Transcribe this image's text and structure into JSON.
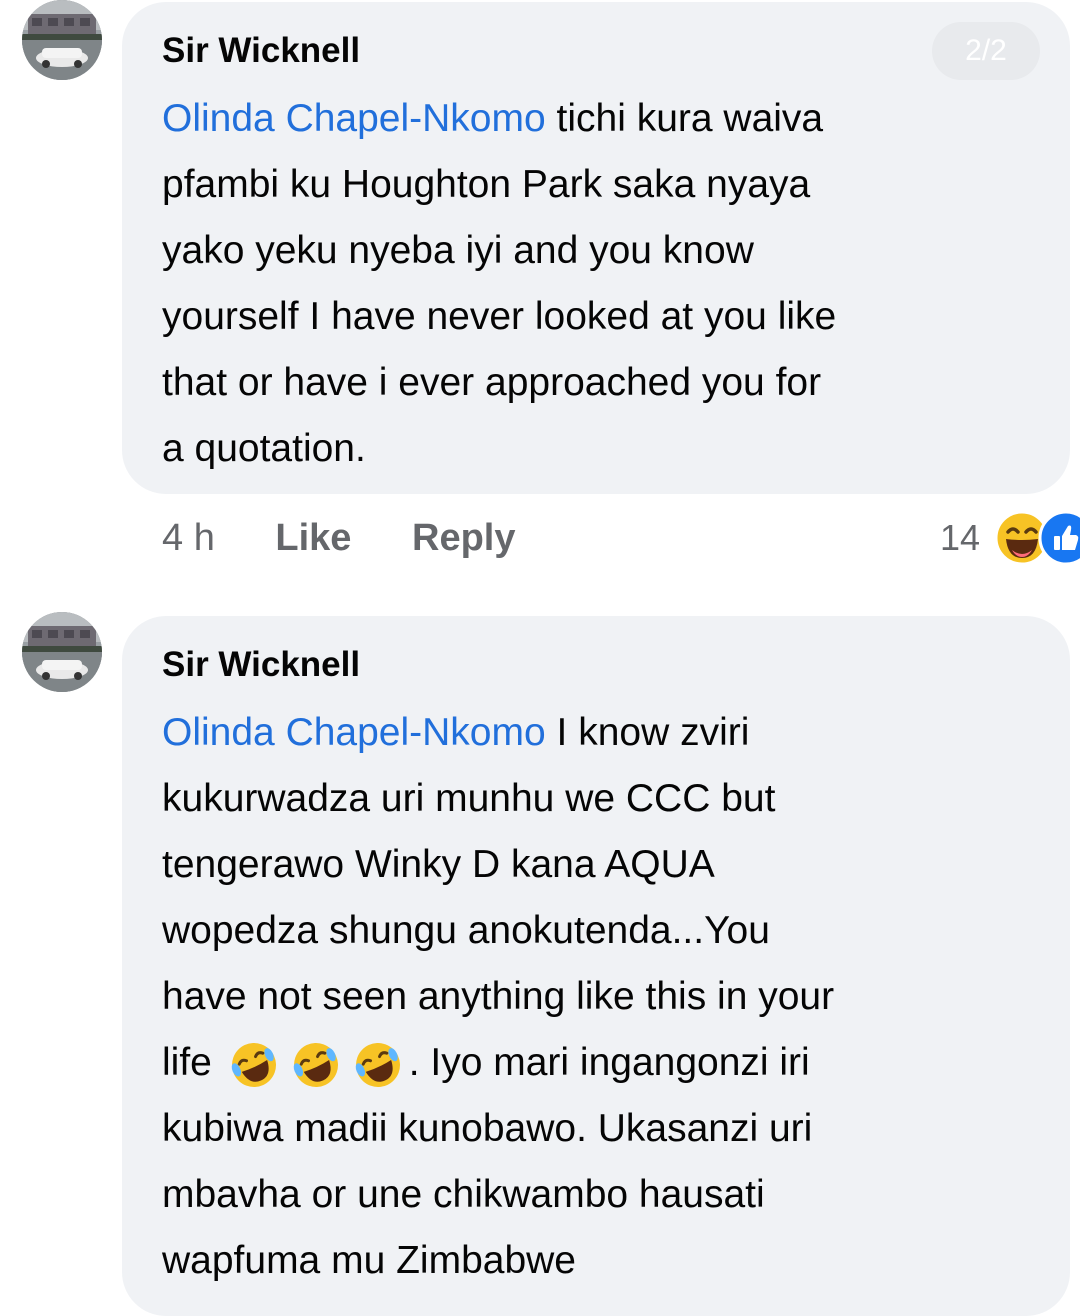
{
  "page_indicator": "2/2",
  "comments": [
    {
      "author": "Sir Wicknell",
      "mention": "Olinda Chapel-Nkomo",
      "text": " tichi kura waiva\npfambi ku Houghton Park saka nyaya\nyako yeku nyeba iyi and you know\nyourself I have never looked at you like\nthat or have i ever approached you for\na quotation.",
      "time": "4 h",
      "like_label": "Like",
      "reply_label": "Reply",
      "reaction_count": "14",
      "reaction_icons": [
        "haha-reaction-icon",
        "like-reaction-icon"
      ]
    },
    {
      "author": "Sir Wicknell",
      "mention": "Olinda Chapel-Nkomo",
      "text_before_emoji": " I know zviri\nkukurwadza uri munhu we CCC but\ntengerawo Winky D kana AQUA\nwopedza shungu anokutenda...You\nhave not seen anything like this in your\nlife ",
      "emojis": [
        "rofl-emoji-icon",
        "rofl-emoji-icon",
        "rofl-emoji-icon"
      ],
      "text_after_emoji": ". Iyo mari ingangonzi iri\nkubiwa madii kunobawo. Ukasanzi uri\nmbavha or une chikwambo hausati\nwapfuma mu Zimbabwe"
    }
  ],
  "colors": {
    "bubble": "#f0f2f5",
    "mention": "#216fdb",
    "meta": "#65676b",
    "like_blue": "#1877f2",
    "emoji_yellow": "#f7c325"
  }
}
